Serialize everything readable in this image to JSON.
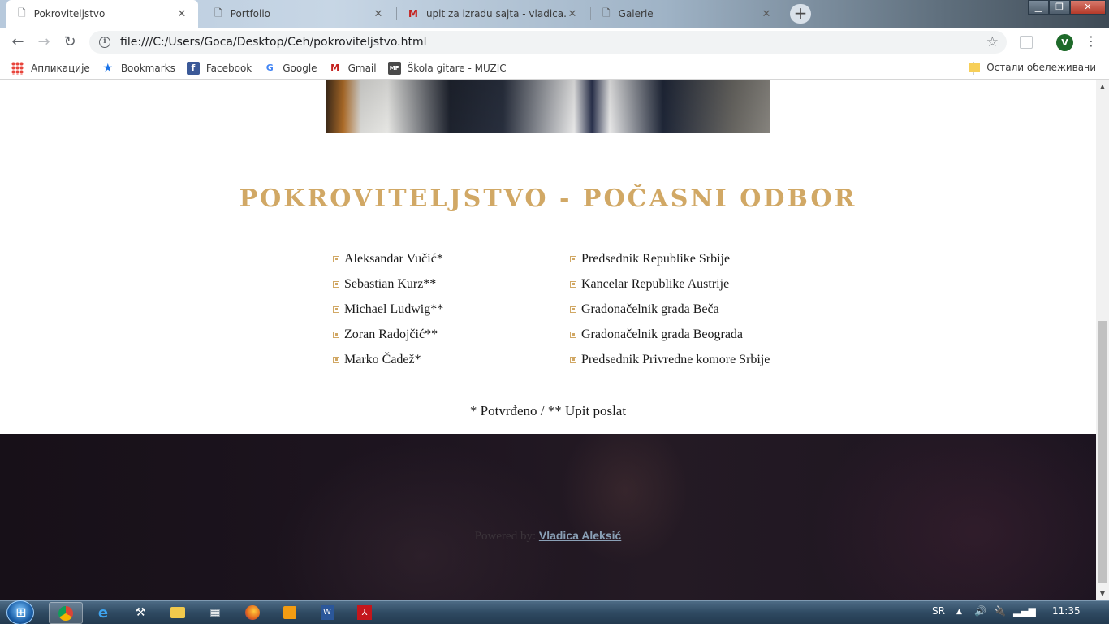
{
  "browser": {
    "tabs": [
      {
        "title": "Pokroviteljstvo",
        "active": true,
        "icon": "page-icon"
      },
      {
        "title": "Portfolio",
        "active": false,
        "icon": "page-icon"
      },
      {
        "title": "upit za izradu sajta - vladica.aleks",
        "active": false,
        "icon": "gmail-icon"
      },
      {
        "title": "Galerie",
        "active": false,
        "icon": "page-icon"
      }
    ],
    "new_tab": "+",
    "url": "file:///C:/Users/Goca/Desktop/Ceh/pokroviteljstvo.html",
    "profile_initial": "V",
    "window_buttons": {
      "minimize": "▁",
      "maximize": "❐",
      "close": "✕"
    },
    "nav": {
      "back": "←",
      "forward": "→",
      "reload": "↻"
    },
    "bookmarks": [
      {
        "label": "Апликације",
        "icon": "apps-grid-icon"
      },
      {
        "label": "Bookmarks",
        "icon": "star-icon"
      },
      {
        "label": "Facebook",
        "icon": "facebook-icon"
      },
      {
        "label": "Google",
        "icon": "google-icon"
      },
      {
        "label": "Gmail",
        "icon": "gmail-icon"
      },
      {
        "label": "Škola gitare - MUZIC",
        "icon": "mf-icon"
      }
    ],
    "other_bookmarks": "Остали обележивачи"
  },
  "page": {
    "section_title": "POKROVITELJSTVO - POČASNI ODBOR",
    "names": [
      "Aleksandar Vučić*",
      "Sebastian Kurz**",
      "Michael Ludwig**",
      "Zoran Radojčić**",
      "Marko Čadež*"
    ],
    "roles": [
      "Predsednik Republike Srbije",
      "Kancelar Republike Austrije",
      "Gradonačelnik grada Beča",
      "Gradonačelnik grada Beograda",
      "Predsednik Privredne komore Srbije"
    ],
    "legend_note": "* Potvrđeno / ** Upit poslat",
    "footer": {
      "powered_by": "Powered by:",
      "author_link": "Vladica Aleksić"
    },
    "accent_color": "#d1a865"
  },
  "taskbar": {
    "apps": [
      "chrome-icon",
      "ie-icon",
      "tools-icon",
      "explorer-icon",
      "calculator-icon",
      "firefox-icon",
      "media-icon",
      "word-icon",
      "pdf-icon"
    ],
    "language": "SR",
    "time": "11:35"
  }
}
